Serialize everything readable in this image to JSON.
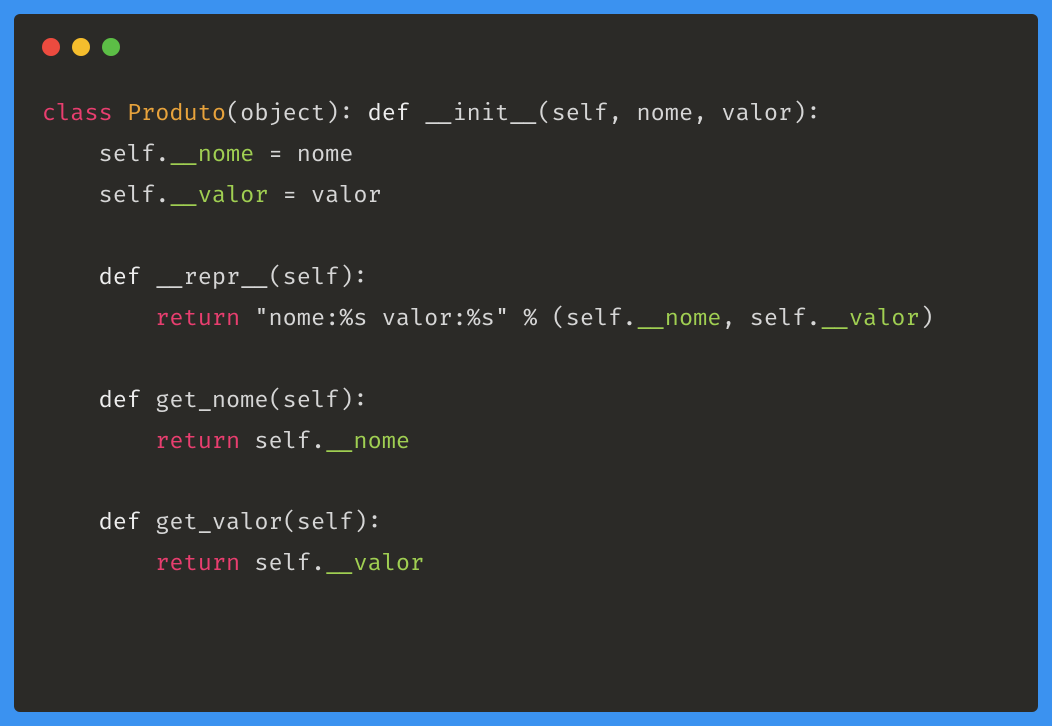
{
  "code": {
    "line1": {
      "kw_class": "class",
      "cls_name": "Produto",
      "paren_obj": "(object): ",
      "kw_def": "def",
      "space1": " ",
      "init_name": "__init__",
      "params": "(self, nome, valor):"
    },
    "line2": {
      "indent": "    self.",
      "attr": "__nome",
      "rest": " = nome"
    },
    "line3": {
      "indent": "    self.",
      "attr": "__valor",
      "rest": " = valor"
    },
    "line5": {
      "indent": "    ",
      "kw_def": "def",
      "space": " ",
      "name": "__repr__",
      "params": "(self):"
    },
    "line6": {
      "indent": "        ",
      "kw_return": "return",
      "space": " ",
      "str": "\"nome:%s valor:%s\"",
      "mid1": " % (self.",
      "attr1": "__nome",
      "mid2": ", self.",
      "attr2": "__valor",
      "end": ")"
    },
    "line8": {
      "indent": "    ",
      "kw_def": "def",
      "rest": " get_nome(self):"
    },
    "line9": {
      "indent": "        ",
      "kw_return": "return",
      "mid": " self.",
      "attr": "__nome"
    },
    "line11": {
      "indent": "    ",
      "kw_def": "def",
      "rest": " get_valor(self):"
    },
    "line12": {
      "indent": "        ",
      "kw_return": "return",
      "mid": " self.",
      "attr": "__valor"
    }
  }
}
